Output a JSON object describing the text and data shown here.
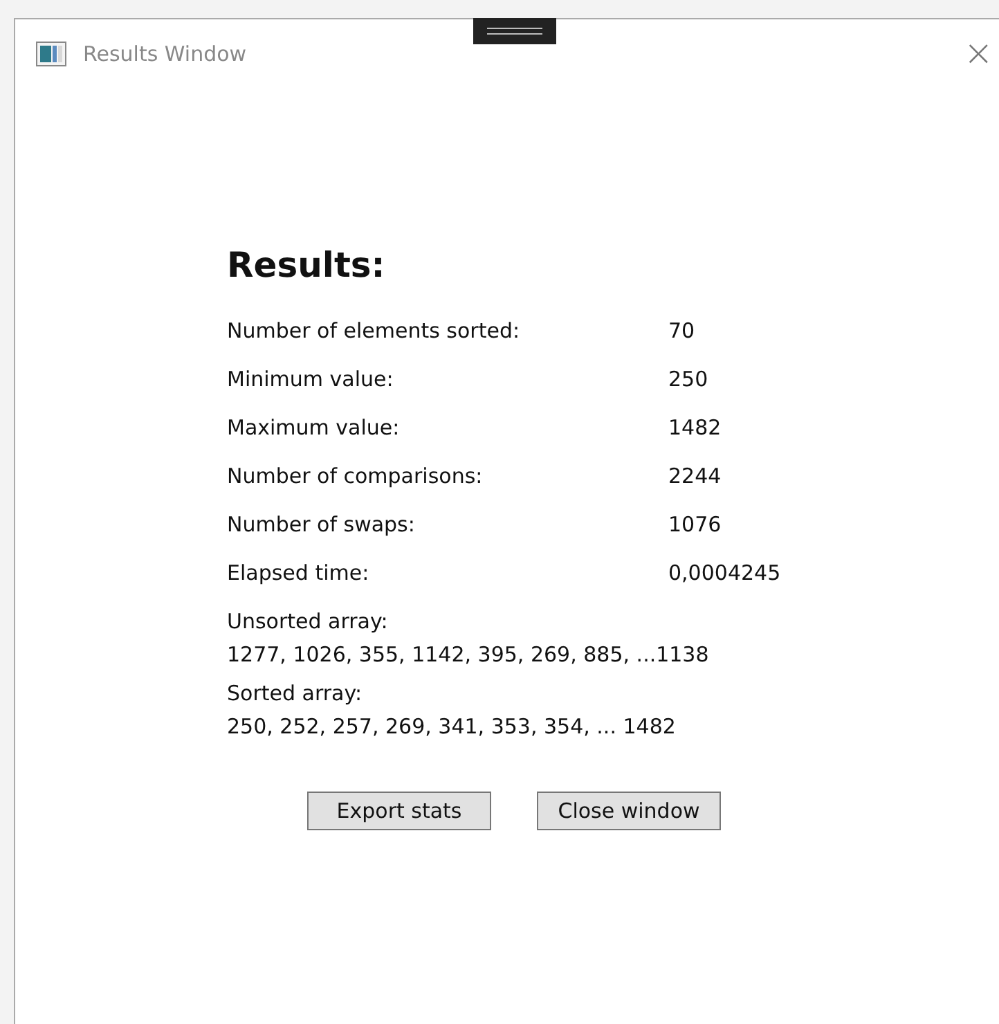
{
  "window": {
    "title": "Results Window",
    "close_glyph": "×"
  },
  "heading": "Results:",
  "stats": [
    {
      "label": "Number of elements sorted:",
      "value": "70"
    },
    {
      "label": "Minimum value:",
      "value": "250"
    },
    {
      "label": "Maximum value:",
      "value": "1482"
    },
    {
      "label": "Number of comparisons:",
      "value": "2244"
    },
    {
      "label": "Number of swaps:",
      "value": "1076"
    },
    {
      "label": "Elapsed time:",
      "value": "0,0004245"
    }
  ],
  "arrays": [
    {
      "label": "Unsorted array:",
      "value": "1277, 1026, 355, 1142, 395, 269, 885, ...1138"
    },
    {
      "label": "Sorted array:",
      "value": "250, 252, 257, 269, 341, 353, 354, ... 1482"
    }
  ],
  "buttons": [
    "Export stats",
    "Close window"
  ]
}
